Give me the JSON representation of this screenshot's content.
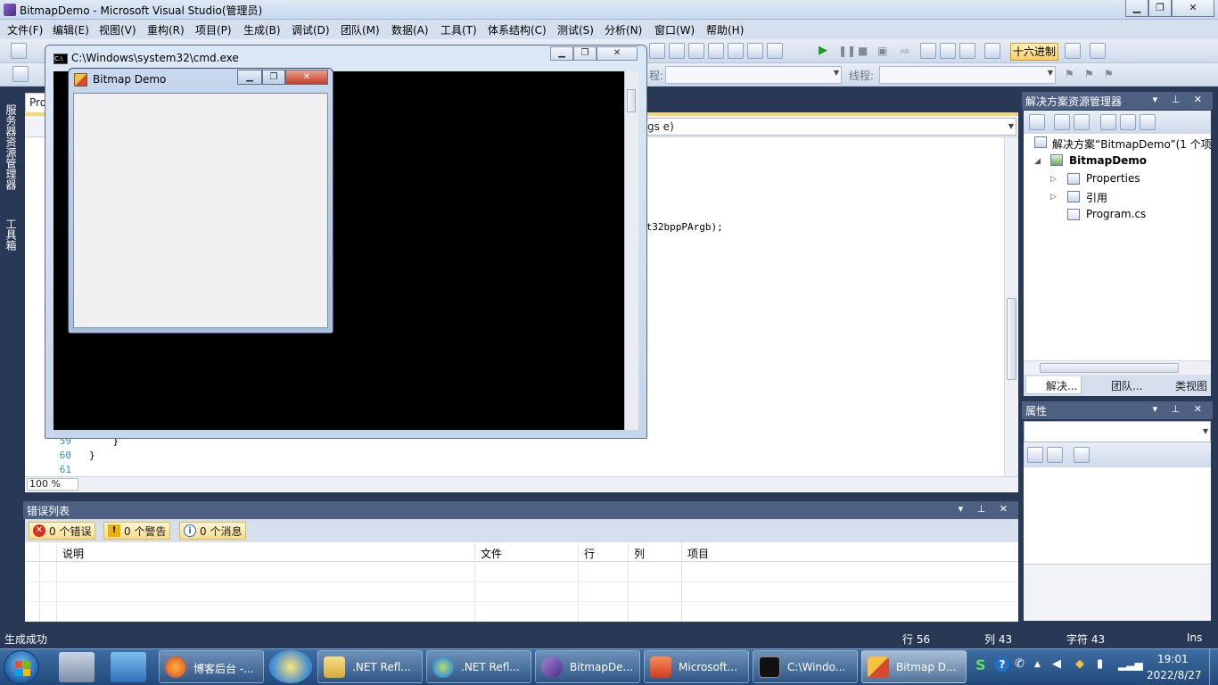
{
  "vs": {
    "title": "BitmapDemo - Microsoft Visual Studio(管理员)"
  },
  "menu": [
    "文件(F)",
    "编辑(E)",
    "视图(V)",
    "重构(R)",
    "项目(P)",
    "生成(B)",
    "调试(D)",
    "团队(M)",
    "数据(A)",
    "工具(T)",
    "体系结构(C)",
    "测试(S)",
    "分析(N)",
    "窗口(W)",
    "帮助(H)"
  ],
  "toolbar": {
    "hex_label": "十六进制",
    "process_label": "程:",
    "thread_label": "线程:"
  },
  "left_strip": {
    "server_explorer": "服务器资源管理器",
    "toolbox": "工具箱"
  },
  "editor": {
    "tab_label": "Pro",
    "nav_right": "gs e)",
    "code_fragment": "at32bppPArgb);",
    "lines": [
      {
        "num": "59",
        "code": "    }"
      },
      {
        "num": "60",
        "code": "}"
      },
      {
        "num": "61",
        "code": ""
      }
    ],
    "zoom": "100 %"
  },
  "cmd": {
    "title": "C:\\Windows\\system32\\cmd.exe"
  },
  "bitmap_demo": {
    "title": "Bitmap Demo"
  },
  "solution_explorer": {
    "title": "解决方案资源管理器",
    "solution": "解决方案“BitmapDemo”(1 个项",
    "project": "BitmapDemo",
    "items": [
      "Properties",
      "引用",
      "Program.cs"
    ],
    "tabs": [
      "解决...",
      "团队...",
      "类视图"
    ]
  },
  "properties": {
    "title": "属性"
  },
  "error_list": {
    "title": "错误列表",
    "errors": "0 个错误",
    "warnings": "0 个警告",
    "messages": "0 个消息",
    "columns": [
      "说明",
      "文件",
      "行",
      "列",
      "项目"
    ]
  },
  "status": {
    "message": "生成成功",
    "row": "行 56",
    "col": "列 43",
    "char": "字符 43",
    "mode": "Ins"
  },
  "taskbar": {
    "buttons": [
      {
        "label": "博客后台 -...",
        "color": "#e8702a"
      },
      {
        "label": ".NET Refl...",
        "color": "#e9c25a"
      },
      {
        "label": ".NET Refl...",
        "color": "#5aa7d9"
      },
      {
        "label": "BitmapDe...",
        "color": "#7b5bb6"
      },
      {
        "label": "Microsoft...",
        "color": "#e2542b"
      },
      {
        "label": "C:\\Windo...",
        "color": "#111111"
      },
      {
        "label": "Bitmap D...",
        "color": "#d7462b"
      }
    ],
    "time": "19:01",
    "date": "2022/8/27"
  }
}
